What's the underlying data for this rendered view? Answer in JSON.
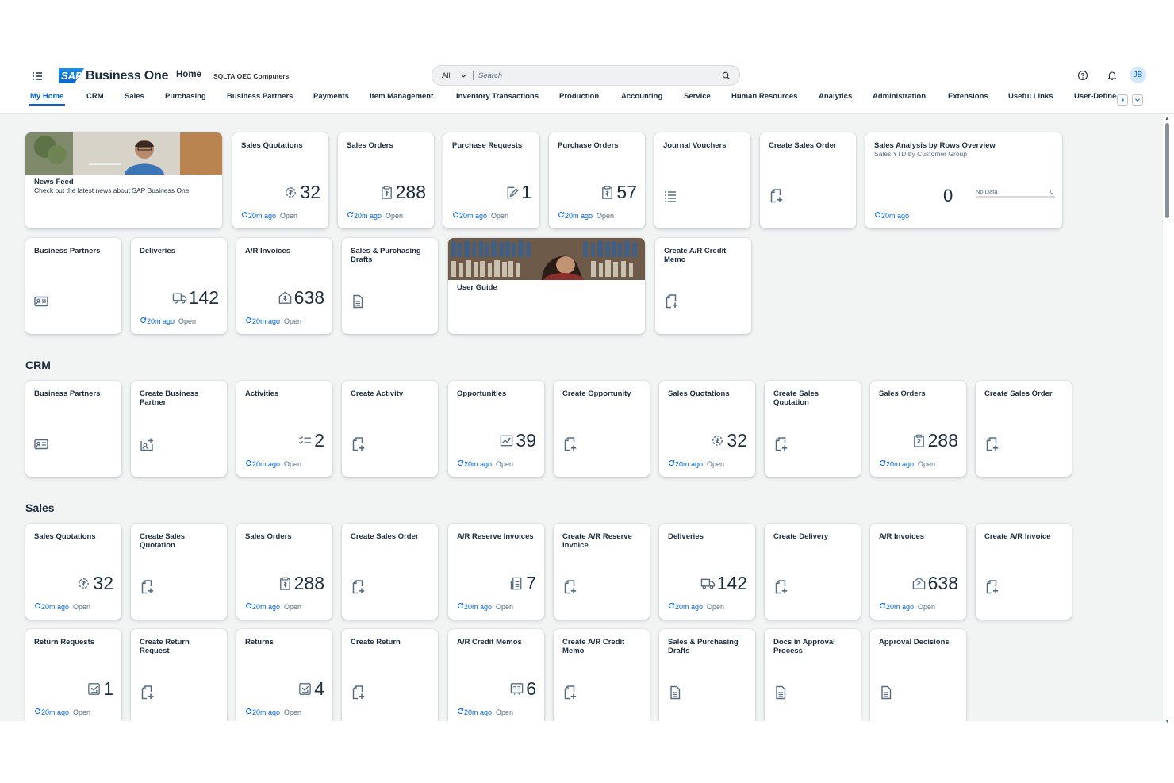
{
  "shell": {
    "brand": "Business One",
    "home": "Home",
    "company": "SQLTA OEC Computers",
    "search_scope": "All",
    "search_placeholder": "Search",
    "avatar": "JB"
  },
  "tabs": [
    "My Home",
    "CRM",
    "Sales",
    "Purchasing",
    "Business Partners",
    "Payments",
    "Item Management",
    "Inventory Transactions",
    "Production",
    "Accounting",
    "Service",
    "Human Resources",
    "Analytics",
    "Administration",
    "Extensions",
    "Useful Links",
    "User-Defined"
  ],
  "common": {
    "ago": "20m ago",
    "open": "Open"
  },
  "home_tiles": {
    "news_title": "News Feed",
    "news_desc": "Check out the latest news about SAP Business One",
    "sales_quotations": {
      "title": "Sales Quotations",
      "value": "32"
    },
    "sales_orders": {
      "title": "Sales Orders",
      "value": "288"
    },
    "purchase_requests": {
      "title": "Purchase Requests",
      "value": "1"
    },
    "purchase_orders": {
      "title": "Purchase Orders",
      "value": "57"
    },
    "journal_vouchers": {
      "title": "Journal Vouchers"
    },
    "create_sales_order": {
      "title": "Create Sales Order"
    },
    "sales_analysis": {
      "title": "Sales Analysis by Rows Overview",
      "subtitle": "Sales YTD by Customer Group",
      "value": "0",
      "nodata": "No Data",
      "nodata_value": "0"
    },
    "business_partners": {
      "title": "Business Partners"
    },
    "deliveries": {
      "title": "Deliveries",
      "value": "142"
    },
    "ar_invoices": {
      "title": "A/R Invoices",
      "value": "638"
    },
    "drafts": {
      "title": "Sales & Purchasing Drafts"
    },
    "user_guide": {
      "title": "User Guide"
    },
    "create_credit_memo": {
      "title": "Create A/R Credit Memo"
    }
  },
  "crm": {
    "section": "CRM",
    "business_partners": "Business Partners",
    "create_bp": "Create Business Partner",
    "activities": {
      "title": "Activities",
      "value": "2"
    },
    "create_activity": "Create Activity",
    "opportunities": {
      "title": "Opportunities",
      "value": "39"
    },
    "create_opportunity": "Create Opportunity",
    "sales_quotations": {
      "title": "Sales Quotations",
      "value": "32"
    },
    "create_sales_quotation": "Create Sales Quotation",
    "sales_orders": {
      "title": "Sales Orders",
      "value": "288"
    },
    "create_sales_order": "Create Sales Order"
  },
  "sales": {
    "section": "Sales",
    "sales_quotations": {
      "title": "Sales Quotations",
      "value": "32"
    },
    "create_sales_quotation": "Create Sales Quotation",
    "sales_orders": {
      "title": "Sales Orders",
      "value": "288"
    },
    "create_sales_order": "Create Sales Order",
    "ar_reserve_invoices": {
      "title": "A/R Reserve Invoices",
      "value": "7"
    },
    "create_ar_reserve": "Create A/R Reserve Invoice",
    "deliveries": {
      "title": "Deliveries",
      "value": "142"
    },
    "create_delivery": "Create Delivery",
    "ar_invoices": {
      "title": "A/R Invoices",
      "value": "638"
    },
    "create_ar_invoice": "Create A/R Invoice",
    "return_requests": {
      "title": "Return Requests",
      "value": "1"
    },
    "create_return_request": "Create Return Request",
    "returns": {
      "title": "Returns",
      "value": "4"
    },
    "create_return": "Create Return",
    "ar_credit_memos": {
      "title": "A/R Credit Memos",
      "value": "6"
    },
    "create_ar_credit_memo": "Create A/R Credit Memo",
    "drafts": "Sales & Purchasing Drafts",
    "docs_approval": "Docs in Approval Process",
    "approval_decisions": "Approval Decisions"
  },
  "colors": {
    "accent": "#0064d9",
    "text": "#1d2d3e",
    "muted": "#556b82",
    "bg": "#f2f3f3"
  }
}
